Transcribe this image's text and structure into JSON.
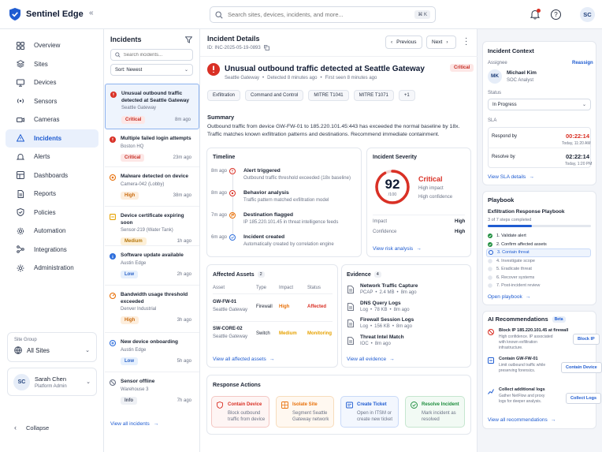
{
  "app": {
    "name": "Sentinel Edge"
  },
  "search": {
    "placeholder": "Search sites, devices, incidents, and more...",
    "shortcut": "⌘ K"
  },
  "user": {
    "initials": "SC",
    "name": "Sarah Chen",
    "role": "Platform Admin"
  },
  "sidebar": {
    "items": [
      {
        "label": "Overview"
      },
      {
        "label": "Sites"
      },
      {
        "label": "Devices"
      },
      {
        "label": "Sensors"
      },
      {
        "label": "Cameras"
      },
      {
        "label": "Incidents"
      },
      {
        "label": "Alerts"
      },
      {
        "label": "Dashboards"
      },
      {
        "label": "Reports"
      },
      {
        "label": "Policies"
      },
      {
        "label": "Automation"
      },
      {
        "label": "Integrations"
      },
      {
        "label": "Administration"
      }
    ],
    "active": "Incidents",
    "site_group_label": "Site Group",
    "site_group_value": "All Sites",
    "collapse": "Collapse"
  },
  "incidents": {
    "title": "Incidents",
    "search_placeholder": "Search incidents...",
    "sort": "Sort: Newest",
    "view_all": "View all incidents",
    "items": [
      {
        "title": "Unusual outbound traffic detected at Seattle Gateway",
        "site": "Seattle Gateway",
        "severity": "Critical",
        "time": "8m ago"
      },
      {
        "title": "Multiple failed login attempts",
        "site": "Boston HQ",
        "severity": "Critical",
        "time": "23m ago"
      },
      {
        "title": "Malware detected on device",
        "site": "Camera-042 (Lobby)",
        "severity": "High",
        "time": "38m ago"
      },
      {
        "title": "Device certificate expiring soon",
        "site": "Sensor-219 (Water Tank)",
        "severity": "Medium",
        "time": "1h ago"
      },
      {
        "title": "Software update available",
        "site": "Austin Edge",
        "severity": "Low",
        "time": "2h ago"
      },
      {
        "title": "Bandwidth usage threshold exceeded",
        "site": "Denver Industrial",
        "severity": "High",
        "time": "3h ago"
      },
      {
        "title": "New device onboarding",
        "site": "Austin Edge",
        "severity": "Low",
        "time": "5h ago"
      },
      {
        "title": "Sensor offline",
        "site": "Warehouse 3",
        "severity": "Info",
        "time": "7h ago"
      }
    ]
  },
  "detail": {
    "header": "Incident Details",
    "id": "ID: INC-2025-05-19-0893",
    "previous": "Previous",
    "next": "Next",
    "title": "Unusual outbound traffic detected at Seattle Gateway",
    "severity": "Critical",
    "site": "Seattle Gateway",
    "detected": "Detected 8 minutes ago",
    "first_seen": "First seen 8 minutes ago",
    "tags": [
      "Exfiltration",
      "Command and Control",
      "MITRE T1041",
      "MITRE T1071",
      "+1"
    ],
    "summary_title": "Summary",
    "summary": "Outbound traffic from device GW-FW-01 to 185.220.101.45:443 has exceeded the normal baseline by 18x. Traffic matches known exfiltration patterns and destinations. Recommend immediate containment.",
    "timeline_title": "Timeline",
    "timeline": [
      {
        "time": "8m ago",
        "title": "Alert triggered",
        "desc": "Outbound traffic threshold exceeded (18x baseline)"
      },
      {
        "time": "8m ago",
        "title": "Behavior analysis",
        "desc": "Traffic pattern matched exfiltration model"
      },
      {
        "time": "7m ago",
        "title": "Destination flagged",
        "desc": "IP 185.220.101.45 in threat intelligence feeds"
      },
      {
        "time": "6m ago",
        "title": "Incident created",
        "desc": "Automatically created by correlation engine"
      }
    ],
    "severity_title": "Incident Severity",
    "score": "92",
    "score_max": "/100",
    "score_label": "Critical",
    "impact_line": "High impact",
    "confidence_line": "High confidence",
    "impact_label": "Impact",
    "impact_value": "High",
    "confidence_label": "Confidence",
    "confidence_value": "High",
    "risk_link": "View risk analysis",
    "assets_title": "Affected Assets",
    "assets_count": "2",
    "assets_headers": [
      "Asset",
      "Type",
      "Impact",
      "Status"
    ],
    "assets": [
      {
        "name": "GW-FW-01",
        "site": "Seattle Gateway",
        "type": "Firewall",
        "impact": "High",
        "status": "Affected"
      },
      {
        "name": "SW-CORE-02",
        "site": "Seattle Gateway",
        "type": "Switch",
        "impact": "Medium",
        "status": "Monitoring"
      }
    ],
    "assets_link": "View all affected assets",
    "evidence_title": "Evidence",
    "evidence_count": "4",
    "evidence": [
      {
        "title": "Network Traffic Capture",
        "meta1": "PCAP",
        "meta2": "2.4 MB",
        "meta3": "8m ago"
      },
      {
        "title": "DNS Query Logs",
        "meta1": "Log",
        "meta2": "78 KB",
        "meta3": "8m ago"
      },
      {
        "title": "Firewall Session Logs",
        "meta1": "Log",
        "meta2": "156 KB",
        "meta3": "8m ago"
      },
      {
        "title": "Threat Intel Match",
        "meta1": "IOC",
        "meta2": "8m ago",
        "meta3": ""
      }
    ],
    "evidence_link": "View all evidence",
    "actions_title": "Response Actions",
    "actions": [
      {
        "title": "Contain Device",
        "desc": "Block outbound traffic from device"
      },
      {
        "title": "Isolate Site",
        "desc": "Segment Seattle Gateway network"
      },
      {
        "title": "Create Ticket",
        "desc": "Open in ITSM or create new ticket"
      },
      {
        "title": "Resolve Incident",
        "desc": "Mark incident as resolved"
      }
    ]
  },
  "context": {
    "title": "Incident Context",
    "assignee_label": "Assignee",
    "reassign": "Reassign",
    "assignee_initials": "MK",
    "assignee_name": "Michael Kim",
    "assignee_role": "SOC Analyst",
    "status_label": "Status",
    "status_value": "In Progress",
    "sla_label": "SLA",
    "respond_label": "Respond by",
    "respond_time": "00:22:14",
    "respond_date": "Today, 11:20 AM",
    "resolve_label": "Resolve by",
    "resolve_time": "02:22:14",
    "resolve_date": "Today, 1:20 PM",
    "sla_link": "View SLA details"
  },
  "playbook": {
    "title": "Playbook",
    "name": "Exfiltration Response Playbook",
    "progress_text": "3 of 7 steps completed",
    "progress": 0.43,
    "steps": [
      "1. Validate alert",
      "2. Confirm affected assets",
      "3. Contain threat",
      "4. Investigate scope",
      "5. Eradicate threat",
      "6. Recover systems",
      "7. Post-incident review"
    ],
    "link": "Open playbook"
  },
  "ai": {
    "title": "AI Recommendations",
    "badge": "Beta",
    "items": [
      {
        "title": "Block IP 185.220.101.45 at firewall",
        "desc": "High confidence. IP associated with known exfiltration infrastructure.",
        "button": "Block IP"
      },
      {
        "title": "Contain GW-FW-01",
        "desc": "Limit outbound traffic while preserving forensics.",
        "button": "Contain Device"
      },
      {
        "title": "Collect additional logs",
        "desc": "Gather NetFlow and proxy logs for deeper analysis.",
        "button": "Collect Logs"
      }
    ],
    "link": "View all recommendations"
  },
  "colors": {
    "accent": "#1f5cd1",
    "critical": "#d93025",
    "high": "#e8710a",
    "medium": "#e6a100",
    "low": "#2f6fdc"
  }
}
